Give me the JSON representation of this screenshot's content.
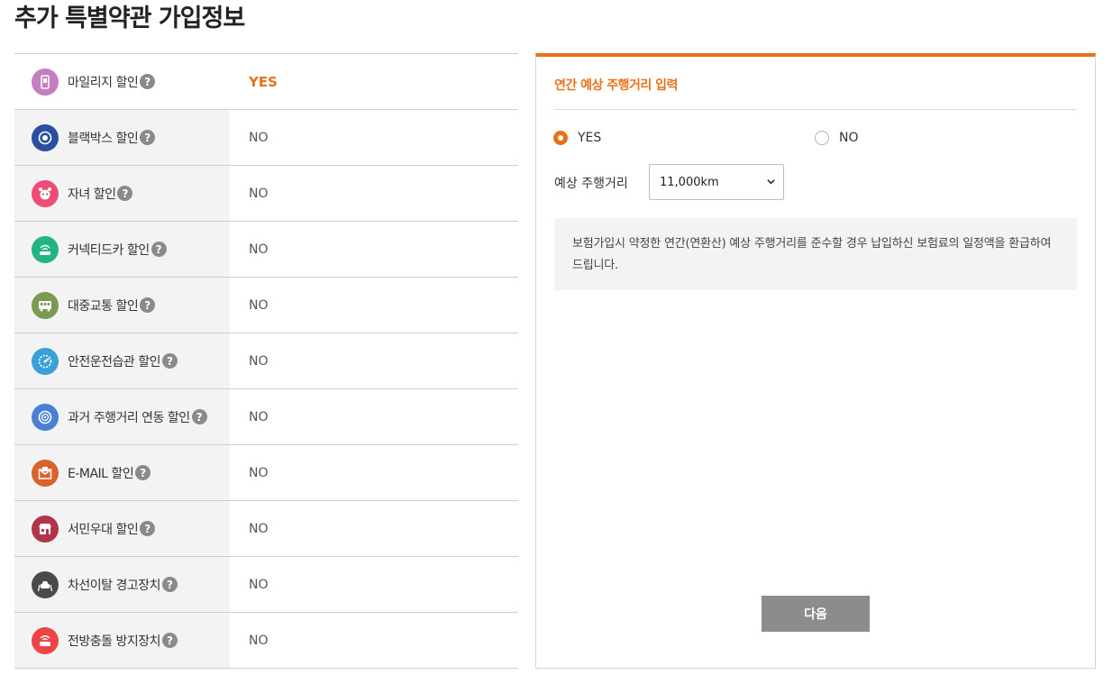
{
  "page": {
    "title": "추가 특별약관 가입정보"
  },
  "discounts": [
    {
      "label": "마일리지 할인",
      "value": "YES",
      "icon": "mileage-phone-icon",
      "color": "#c57fc0",
      "highlight": true
    },
    {
      "label": "블랙박스 할인",
      "value": "NO",
      "icon": "blackbox-camera-icon",
      "color": "#2b4fa0",
      "highlight": false
    },
    {
      "label": "자녀 할인",
      "value": "NO",
      "icon": "child-face-icon",
      "color": "#ee4c74",
      "highlight": false
    },
    {
      "label": "커넥티드카 할인",
      "value": "NO",
      "icon": "connected-car-icon",
      "color": "#22b481",
      "highlight": false
    },
    {
      "label": "대중교통 할인",
      "value": "NO",
      "icon": "bus-icon",
      "color": "#7a9a52",
      "highlight": false
    },
    {
      "label": "안전운전습관 할인",
      "value": "NO",
      "icon": "speedometer-icon",
      "color": "#3aa0d6",
      "highlight": false
    },
    {
      "label": "과거 주행거리 연동 할인",
      "value": "NO",
      "icon": "odometer-icon",
      "color": "#4a7fd6",
      "highlight": false
    },
    {
      "label": "E-MAIL 할인",
      "value": "NO",
      "icon": "email-icon",
      "color": "#d9632c",
      "highlight": false
    },
    {
      "label": "서민우대 할인",
      "value": "NO",
      "icon": "store-icon",
      "color": "#b1344a",
      "highlight": false
    },
    {
      "label": "차선이탈 경고장치",
      "value": "NO",
      "icon": "lane-departure-icon",
      "color": "#4a4a4a",
      "highlight": false
    },
    {
      "label": "전방충돌 방지장치",
      "value": "NO",
      "icon": "collision-warning-icon",
      "color": "#ef4444",
      "highlight": false
    }
  ],
  "help_symbol": "?",
  "panel": {
    "title": "연간 예상 주행거리 입력",
    "radio_yes": "YES",
    "radio_no": "NO",
    "selected": "YES",
    "distance_label": "예상 주행거리",
    "distance_value": "11,000km",
    "info_text": "보험가입시 약정한 연간(연환산) 예상 주행거리를 준수할 경우 납입하신 보험료의 일정액을 환급하여 드립니다.",
    "next_button": "다음"
  },
  "colors": {
    "accent": "#e8711a",
    "button_gray": "#8c8c8c"
  }
}
